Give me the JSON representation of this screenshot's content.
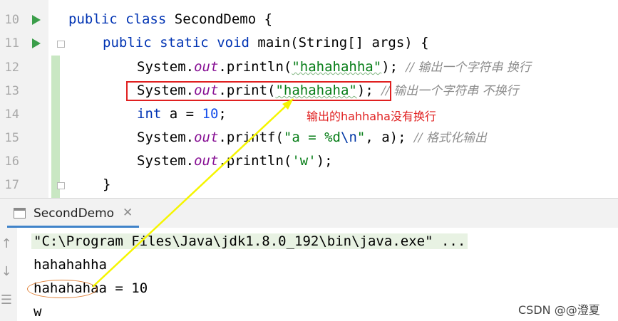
{
  "editor": {
    "lines": [
      {
        "num": "10"
      },
      {
        "num": "11"
      },
      {
        "num": "12"
      },
      {
        "num": "13"
      },
      {
        "num": "14"
      },
      {
        "num": "15"
      },
      {
        "num": "16"
      },
      {
        "num": "17"
      }
    ],
    "code": {
      "l10": {
        "kw1": "public",
        "kw2": "class",
        "name": "SecondDemo {"
      },
      "l11": {
        "kw1": "public",
        "kw2": "static",
        "kw3": "void",
        "rest": "main(String[] args) {"
      },
      "l12": {
        "obj": "System.",
        "field": "out",
        "call": ".println(",
        "str": "\"hahahahha\"",
        "end": ");",
        "comment": "// 输出一个字符串 换行"
      },
      "l13": {
        "obj": "System.",
        "field": "out",
        "call": ".print(",
        "str": "\"hahahaha\"",
        "end": ");",
        "comment": "// 输出一个字符串 不换行"
      },
      "l14": {
        "kw": "int",
        "mid": " a = ",
        "num": "10",
        "end": ";"
      },
      "l15": {
        "obj": "System.",
        "field": "out",
        "call": ".printf(",
        "str1": "\"a = %d",
        "esc": "\\n",
        "str2": "\"",
        "end": ", a);",
        "comment": "// 格式化输出"
      },
      "l16": {
        "obj": "System.",
        "field": "out",
        "call": ".println(",
        "str": "'w'",
        "end": ");"
      },
      "l17": {
        "brace": "}"
      }
    }
  },
  "annotation": {
    "text": "输出的hahhaha没有换行",
    "color": "#e02020"
  },
  "console": {
    "tab_title": "SecondDemo",
    "tab_close": "✕",
    "toolbar": {
      "up": "↑",
      "down": "↓",
      "wrap": "☰"
    },
    "output": [
      "\"C:\\Program Files\\Java\\jdk1.8.0_192\\bin\\java.exe\" ...",
      "hahahahha",
      "hahahahaa = 10",
      "w"
    ]
  },
  "watermark": "CSDN @@澄夏",
  "colors": {
    "keyword": "#0033b3",
    "string": "#067d17",
    "field": "#871094",
    "comment": "#8c8c8c",
    "run": "#3b9e4a",
    "arrow": "#f5f500",
    "circle": "#e0823a"
  }
}
